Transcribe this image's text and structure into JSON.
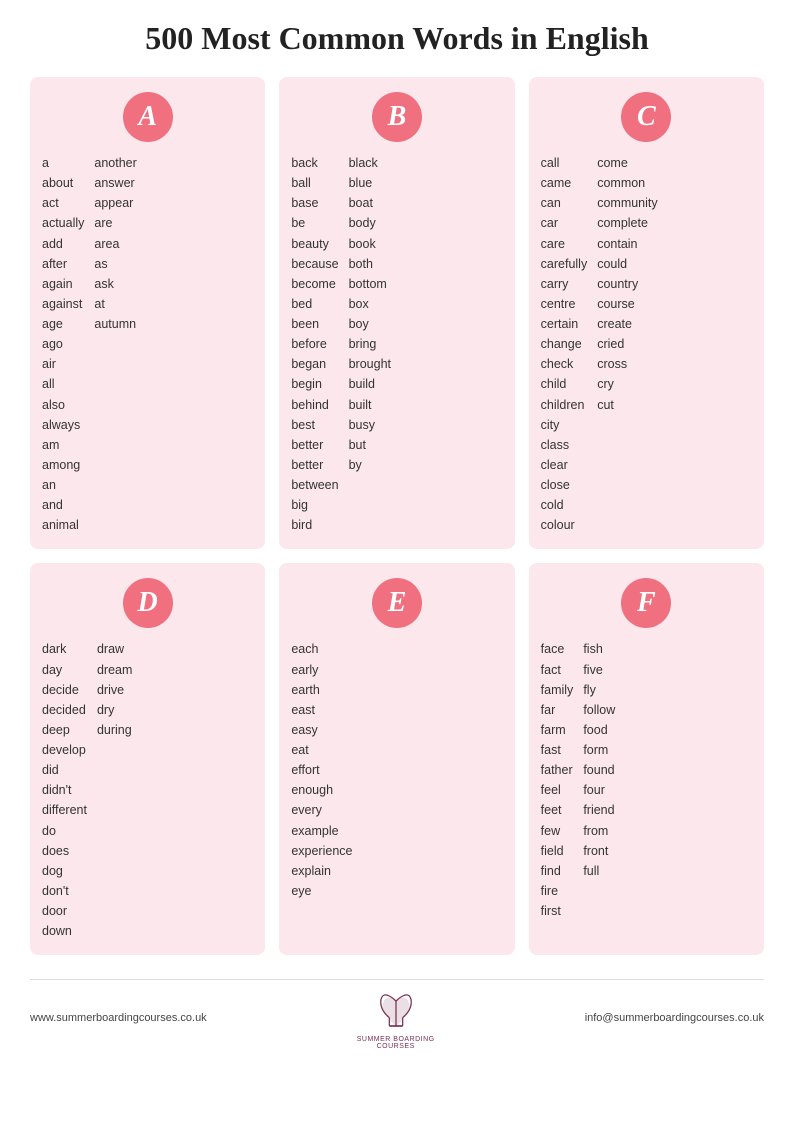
{
  "title": "500 Most Common Words in English",
  "sections": [
    {
      "letter": "A",
      "columns": [
        [
          "a",
          "about",
          "act",
          "actually",
          "add",
          "after",
          "again",
          "against",
          "age",
          "ago",
          "air",
          "all",
          "also",
          "always",
          "am",
          "among",
          "an",
          "and",
          "animal"
        ],
        [
          "another",
          "answer",
          "appear",
          "are",
          "area",
          "as",
          "ask",
          "at",
          "autumn"
        ]
      ]
    },
    {
      "letter": "B",
      "columns": [
        [
          "back",
          "ball",
          "base",
          "be",
          "beauty",
          "because",
          "become",
          "bed",
          "been",
          "before",
          "began",
          "begin",
          "behind",
          "best",
          "better",
          "better",
          "between",
          "big",
          "bird"
        ],
        [
          "black",
          "blue",
          "boat",
          "body",
          "book",
          "both",
          "bottom",
          "box",
          "boy",
          "bring",
          "brought",
          "build",
          "built",
          "busy",
          "but",
          "by"
        ]
      ]
    },
    {
      "letter": "C",
      "columns": [
        [
          "call",
          "came",
          "can",
          "car",
          "care",
          "carefully",
          "carry",
          "centre",
          "certain",
          "change",
          "check",
          "child",
          "children",
          "city",
          "class",
          "clear",
          "close",
          "cold",
          "colour"
        ],
        [
          "come",
          "common",
          "community",
          "complete",
          "contain",
          "could",
          "country",
          "course",
          "create",
          "cried",
          "cross",
          "cry",
          "cut"
        ]
      ]
    },
    {
      "letter": "D",
      "columns": [
        [
          "dark",
          "day",
          "decide",
          "decided",
          "deep",
          "develop",
          "did",
          "didn't",
          "different",
          "do",
          "does",
          "dog",
          "don't",
          "door",
          "down"
        ],
        [
          "draw",
          "dream",
          "drive",
          "dry",
          "during"
        ]
      ]
    },
    {
      "letter": "E",
      "columns": [
        [
          "each",
          "early",
          "earth",
          "east",
          "easy",
          "eat",
          "effort",
          "enough",
          "every",
          "example",
          "experience",
          "explain",
          "eye"
        ]
      ]
    },
    {
      "letter": "F",
      "columns": [
        [
          "face",
          "fact",
          "family",
          "far",
          "farm",
          "fast",
          "father",
          "feel",
          "feet",
          "few",
          "field",
          "find",
          "fire",
          "first"
        ],
        [
          "fish",
          "five",
          "fly",
          "follow",
          "food",
          "form",
          "found",
          "four",
          "friend",
          "from",
          "front",
          "full"
        ]
      ]
    }
  ],
  "footer": {
    "left": "www.summerboardingcourses.co.uk",
    "right": "info@summerboardingcourses.co.uk",
    "logo_line1": "SUMMER BOARDING",
    "logo_line2": "COURSES"
  }
}
